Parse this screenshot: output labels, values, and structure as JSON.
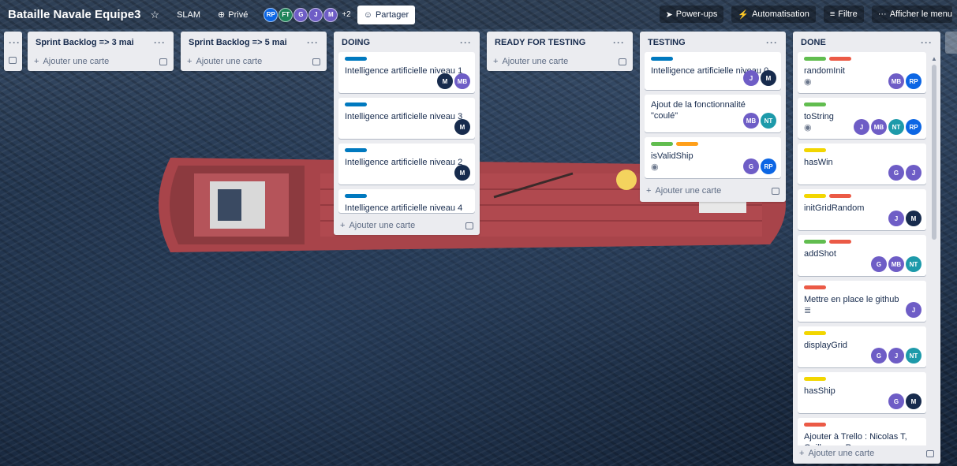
{
  "topbar": {
    "board_title": "Bataille Navale Equipe3",
    "workspace": "SLAM",
    "visibility": "Privé",
    "member_avatars": [
      {
        "initials": "RP",
        "color": "#0c66e4"
      },
      {
        "initials": "FT",
        "color": "#1f845a"
      },
      {
        "initials": "G",
        "color": "#6e5dc6"
      },
      {
        "initials": "J",
        "color": "#6e5dc6"
      },
      {
        "initials": "M",
        "color": "#6e5dc6"
      }
    ],
    "more_members": "+2",
    "share_label": "Partager",
    "powerups_label": "Power-ups",
    "automation_label": "Automatisation",
    "filter_label": "Filtre",
    "show_menu_label": "Afficher le menu"
  },
  "colors": {
    "label_blue": "#0079bf",
    "label_green": "#61bd4f",
    "label_red": "#eb5a46",
    "label_orange": "#ff9f1a",
    "label_yellow": "#f2d600",
    "avatar_purple": "#6e5dc6",
    "avatar_dark": "#172b4d",
    "avatar_blue": "#0c66e4",
    "avatar_teal": "#1d9aaa"
  },
  "add_card_label": "Ajouter une carte",
  "lists": [
    {
      "title": "",
      "cards": []
    },
    {
      "title": "Sprint Backlog => 3 mai",
      "cards": []
    },
    {
      "title": "Sprint Backlog => 5 mai",
      "cards": []
    },
    {
      "title": "DOING",
      "cards": [
        {
          "title": "Intelligence artificielle niveau 1",
          "labels": [
            "blue"
          ],
          "members": [
            "M",
            "MB"
          ]
        },
        {
          "title": "Intelligence artificielle niveau 3",
          "labels": [
            "blue"
          ],
          "members": [
            "M"
          ]
        },
        {
          "title": "Intelligence artificielle niveau 2",
          "labels": [
            "blue"
          ],
          "members": [
            "M"
          ]
        },
        {
          "title": "Intelligence artificielle niveau 4",
          "labels": [
            "blue"
          ],
          "members": []
        }
      ]
    },
    {
      "title": "READY FOR TESTING",
      "cards": []
    },
    {
      "title": "TESTING",
      "cards": [
        {
          "title": "Intelligence artificielle niveau 0",
          "labels": [
            "blue"
          ],
          "members": [
            "J",
            "M"
          ]
        },
        {
          "title": "Ajout de la fonctionnalité \"coulé\"",
          "labels": [],
          "members": [
            "MB",
            "NT"
          ]
        },
        {
          "title": "isValidShip",
          "labels": [
            "green",
            "orange"
          ],
          "badge": "watch",
          "members": [
            "G",
            "RP"
          ]
        }
      ]
    },
    {
      "title": "DONE",
      "cards": [
        {
          "title": "randomInit",
          "labels": [
            "green",
            "red"
          ],
          "badge": "watch",
          "members": [
            "MB",
            "RP"
          ]
        },
        {
          "title": "toString",
          "labels": [
            "green"
          ],
          "badge": "watch",
          "members": [
            "J",
            "MB",
            "NT",
            "RP"
          ]
        },
        {
          "title": "hasWin",
          "labels": [
            "yellow"
          ],
          "members": [
            "G",
            "J"
          ]
        },
        {
          "title": "initGridRandom",
          "labels": [
            "yellow",
            "red"
          ],
          "members": [
            "J",
            "M"
          ]
        },
        {
          "title": "addShot",
          "labels": [
            "green",
            "red"
          ],
          "members": [
            "G",
            "MB",
            "NT"
          ]
        },
        {
          "title": "Mettre en place le github",
          "labels": [
            "red"
          ],
          "badge": "description",
          "members": [
            "J"
          ]
        },
        {
          "title": "displayGrid",
          "labels": [
            "yellow"
          ],
          "members": [
            "G",
            "J",
            "NT"
          ]
        },
        {
          "title": "hasShip",
          "labels": [
            "yellow"
          ],
          "members": [
            "G",
            "M"
          ]
        },
        {
          "title": "Ajouter à Trello : Nicolas T, Guillaume P",
          "labels": [
            "red"
          ],
          "members": []
        }
      ]
    }
  ],
  "icons": {
    "star": "☆",
    "lock": "🔒",
    "share": "👥",
    "rocket": "🚀",
    "bolt": "⚡",
    "filter": "≡",
    "more": "···",
    "plus": "+",
    "watch": "◉",
    "description": "≣"
  }
}
